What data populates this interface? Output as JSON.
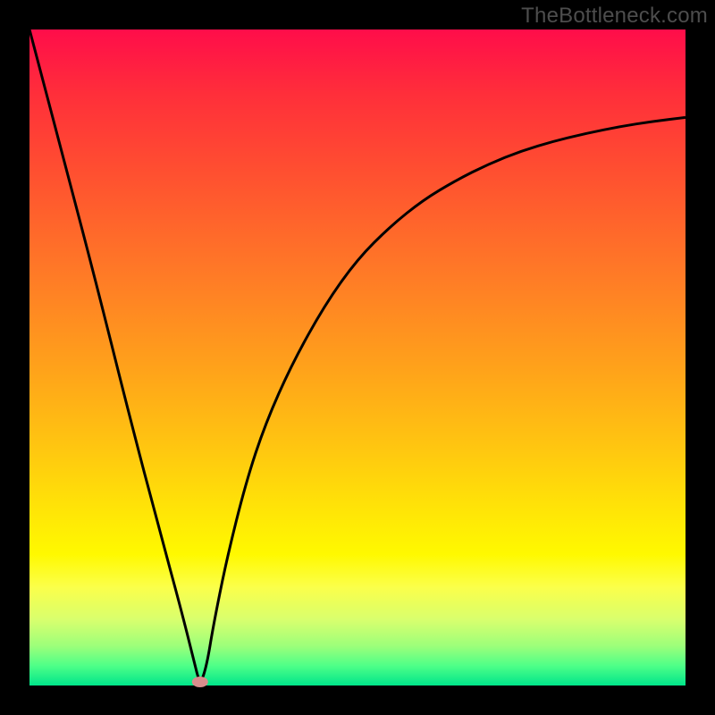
{
  "watermark": "TheBottleneck.com",
  "chart_data": {
    "type": "line",
    "title": "",
    "xlabel": "",
    "ylabel": "",
    "xlim": [
      0,
      100
    ],
    "ylim": [
      0,
      100
    ],
    "background_gradient": {
      "direction": "vertical",
      "stops": [
        {
          "pos": 0,
          "color": "#ff0d4a"
        },
        {
          "pos": 22,
          "color": "#ff5030"
        },
        {
          "pos": 52,
          "color": "#ffa31a"
        },
        {
          "pos": 74,
          "color": "#ffe706"
        },
        {
          "pos": 90,
          "color": "#d8ff6e"
        },
        {
          "pos": 100,
          "color": "#00e58a"
        }
      ]
    },
    "series": [
      {
        "name": "bottleneck-curve",
        "color": "#000000",
        "x": [
          0,
          5,
          10,
          15,
          20,
          23,
          25,
          26,
          27,
          28,
          30,
          33,
          36,
          40,
          45,
          50,
          55,
          60,
          65,
          70,
          75,
          80,
          85,
          90,
          95,
          100
        ],
        "y": [
          100,
          81,
          62,
          42,
          23,
          12,
          4,
          0,
          3,
          9,
          19,
          31,
          40,
          49,
          58,
          65,
          70,
          74,
          77,
          79.5,
          81.5,
          83,
          84.2,
          85.2,
          86,
          86.6
        ]
      }
    ],
    "marker": {
      "name": "dip-marker",
      "shape": "ellipse",
      "x": 26,
      "y": 0,
      "color": "#d98d8d"
    }
  }
}
